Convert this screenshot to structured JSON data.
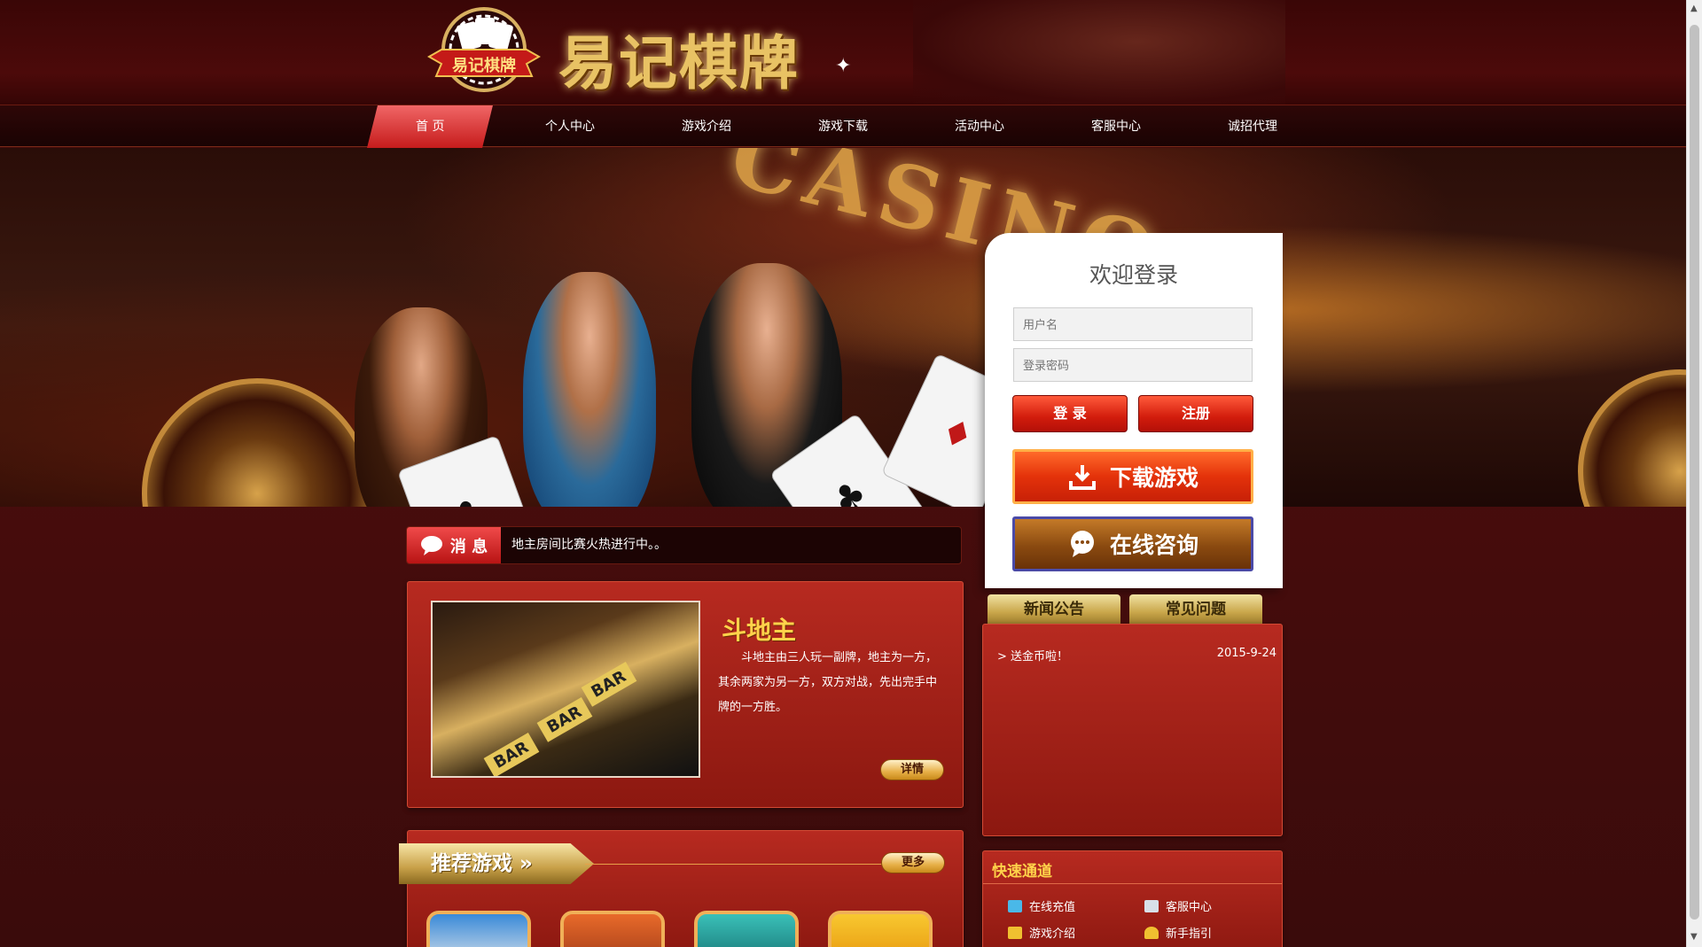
{
  "header": {
    "logo_text": "易记棋牌",
    "badge_text": "易记棋牌"
  },
  "nav": {
    "items": [
      {
        "label": "首  页",
        "active": true
      },
      {
        "label": "个人中心"
      },
      {
        "label": "游戏介绍"
      },
      {
        "label": "游戏下载"
      },
      {
        "label": "活动中心"
      },
      {
        "label": "客服中心"
      },
      {
        "label": "诚招代理"
      }
    ]
  },
  "banner": {
    "sign_text": "CASINO"
  },
  "login": {
    "title": "欢迎登录",
    "username_placeholder": "用户名",
    "password_placeholder": "登录密码",
    "login_label": "登 录",
    "register_label": "注册",
    "download_label": "下载游戏",
    "consult_label": "在线咨询"
  },
  "news_bar": {
    "label": "消 息",
    "text": "地主房间比赛火热进行中。。"
  },
  "featured_game": {
    "title": "斗地主",
    "description": "斗地主由三人玩一副牌，地主为一方，其余两家为另一方，双方对战，先出完手中牌的一方胜。",
    "details_label": "详情"
  },
  "recommended": {
    "title": "推荐游戏",
    "more_label": "更多"
  },
  "tabs": {
    "news": "新闻公告",
    "faq": "常见问题"
  },
  "news_list": [
    {
      "title": "> 送金币啦！",
      "date": "2015-9-24"
    }
  ],
  "quick": {
    "title": "快速通道",
    "links": [
      "在线充值",
      "客服中心",
      "游戏介绍",
      "新手指引"
    ]
  },
  "colors": {
    "accent_red": "#d21c0c",
    "gold": "#ffd24a",
    "bg": "#3a0b0b"
  }
}
